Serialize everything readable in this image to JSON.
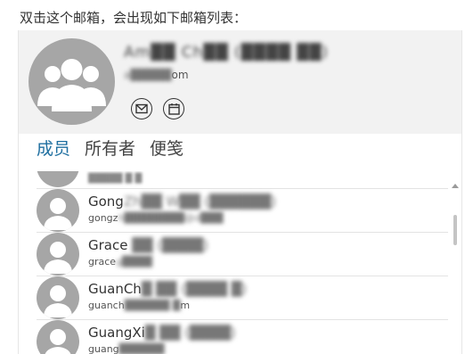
{
  "caption": "双击这个邮箱，会出现如下邮箱列表：",
  "header": {
    "name": "Am██ Ch██ (████ ██)",
    "email_prefix": "a█████",
    "email_suffix": "om",
    "icons": [
      "mail-icon",
      "calendar-icon"
    ]
  },
  "tabs": [
    {
      "label": "成员",
      "active": true
    },
    {
      "label": "所有者",
      "active": false
    },
    {
      "label": "便笺",
      "active": false
    }
  ],
  "members": [
    {
      "name_visible": "Gong",
      "name_blurred": "Zh██ W██ (██████)",
      "email_visible": "gongz",
      "email_blurred": "h████████@d███"
    },
    {
      "name_visible": "Grace",
      "name_blurred": " ██ (████)",
      "email_visible": "grace",
      "email_blurred": "g████"
    },
    {
      "name_visible": "GuanCh",
      "name_blurred": "█ ██ (████ █)",
      "email_visible": "guanch",
      "email_blurred": "██████ █",
      "email_tail": "m"
    },
    {
      "name_visible": "GuangXi",
      "name_blurred": "█ ██ (████)",
      "email_visible": "guang",
      "email_blurred": "██████"
    }
  ],
  "colors": {
    "accent": "#1f6fa0",
    "avatar": "#a6a6a6",
    "header_bg": "#f2f2f2"
  }
}
